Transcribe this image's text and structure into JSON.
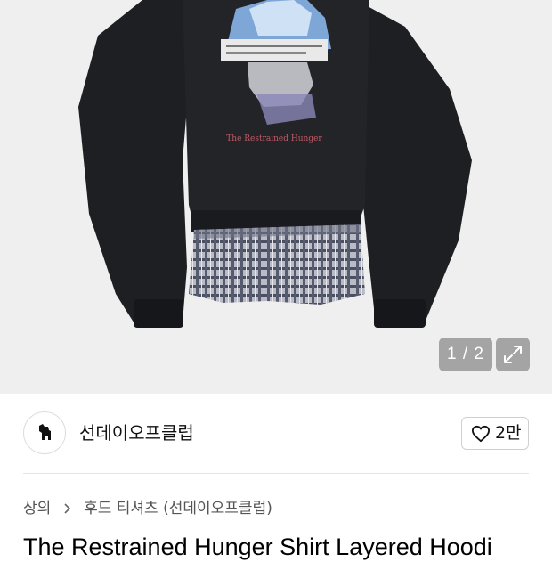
{
  "gallery": {
    "image_alt_icon": "product-photo",
    "pager_text": "1 / 2",
    "expand_icon": "expand-arrows-icon",
    "print_caption": "The Restrained Hunger"
  },
  "seller": {
    "avatar_icon": "dog-logo",
    "name": "선데이오프클럽"
  },
  "like": {
    "icon": "heart-outline-icon",
    "count": "2만"
  },
  "breadcrumb": {
    "level1": "상의",
    "separator_icon": "chevron-right-icon",
    "level2": "후드 티셔츠 (선데이오프클럽)"
  },
  "product": {
    "title": "The Restrained Hunger Shirt Layered Hoodi"
  }
}
